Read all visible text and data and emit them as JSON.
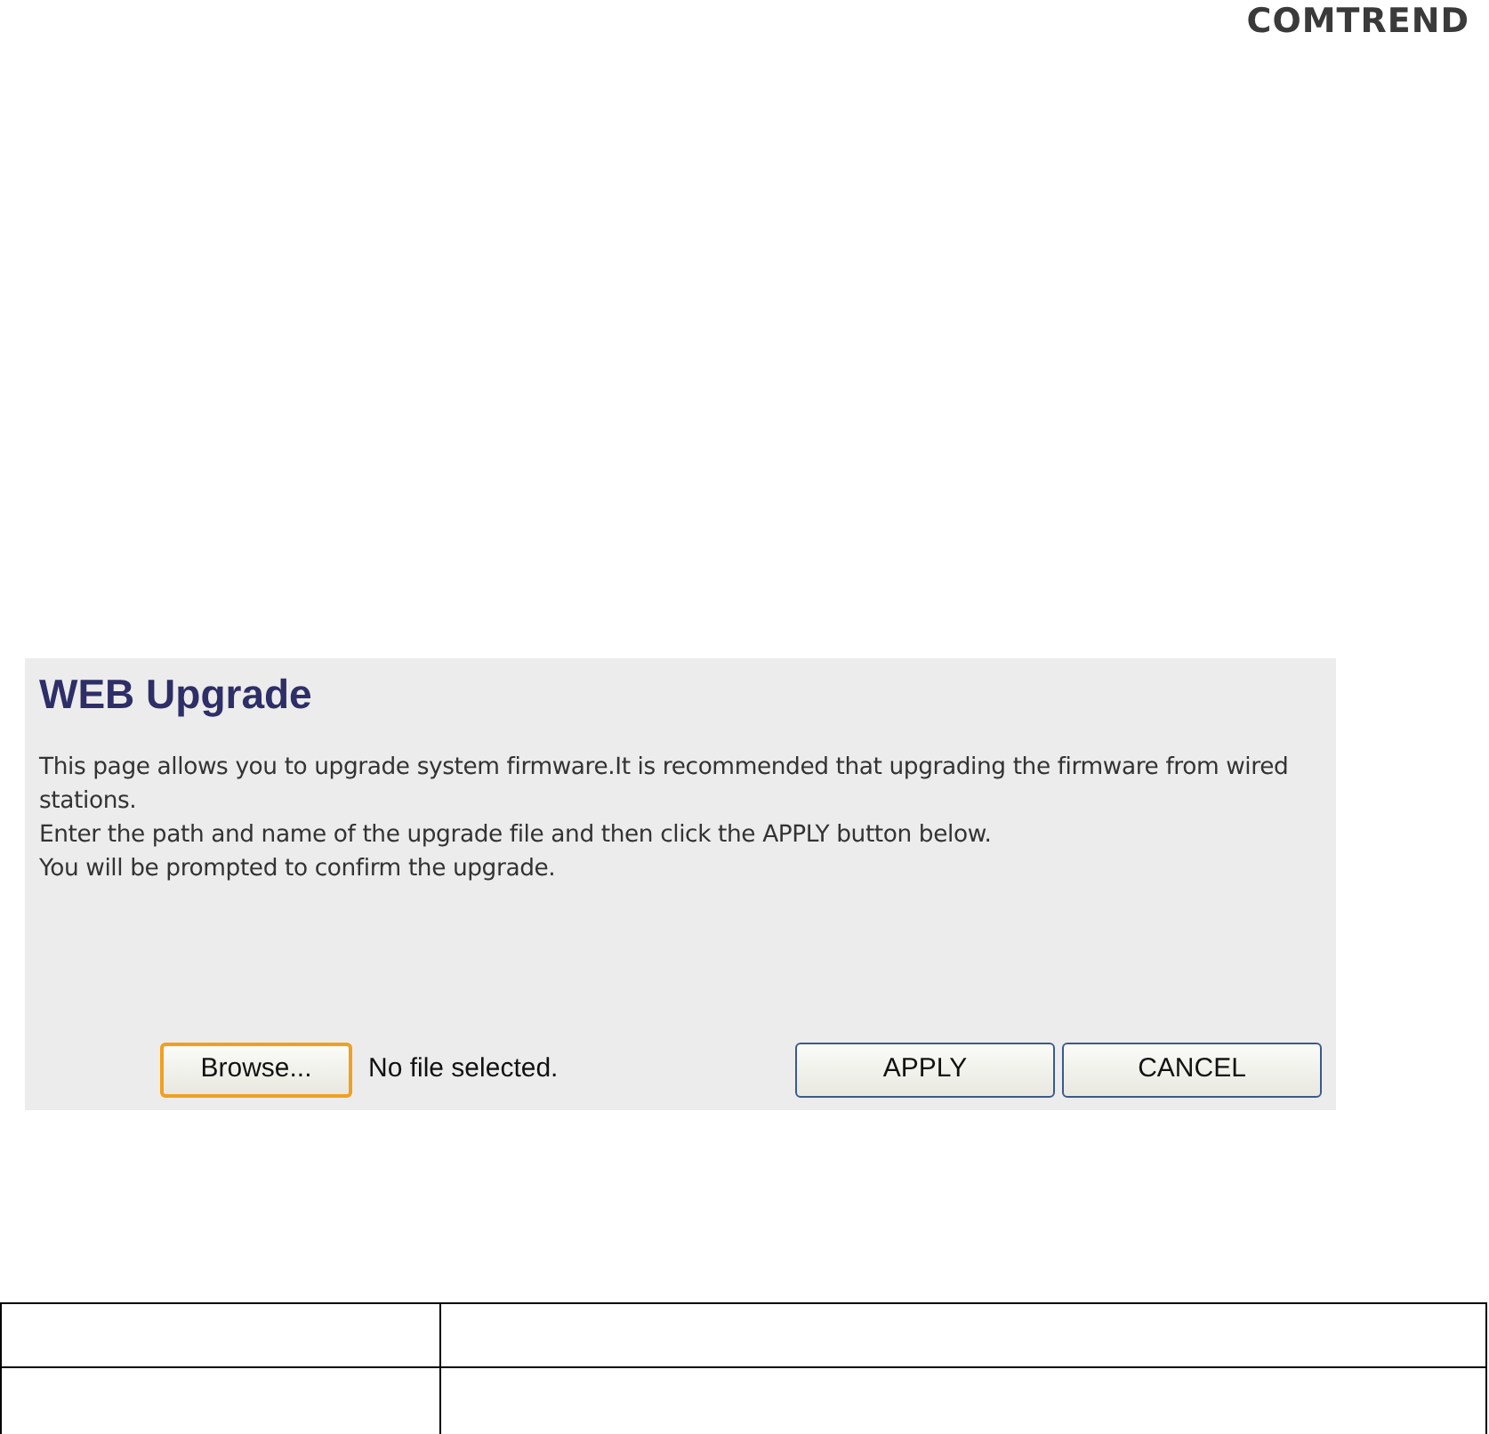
{
  "logo": {
    "text": "COMTREND"
  },
  "panel": {
    "title": "WEB Upgrade",
    "paragraphs": [
      "This page allows you to upgrade system firmware.It is recommended that upgrading the firmware from wired stations.",
      "Enter the path and name of the upgrade file and then click the APPLY button below.",
      "You will be prompted to confirm the upgrade."
    ],
    "file_picker": {
      "button": "Browse...",
      "focused": true,
      "status": "No file selected."
    },
    "buttons": [
      "APPLY",
      "CANCEL"
    ]
  }
}
